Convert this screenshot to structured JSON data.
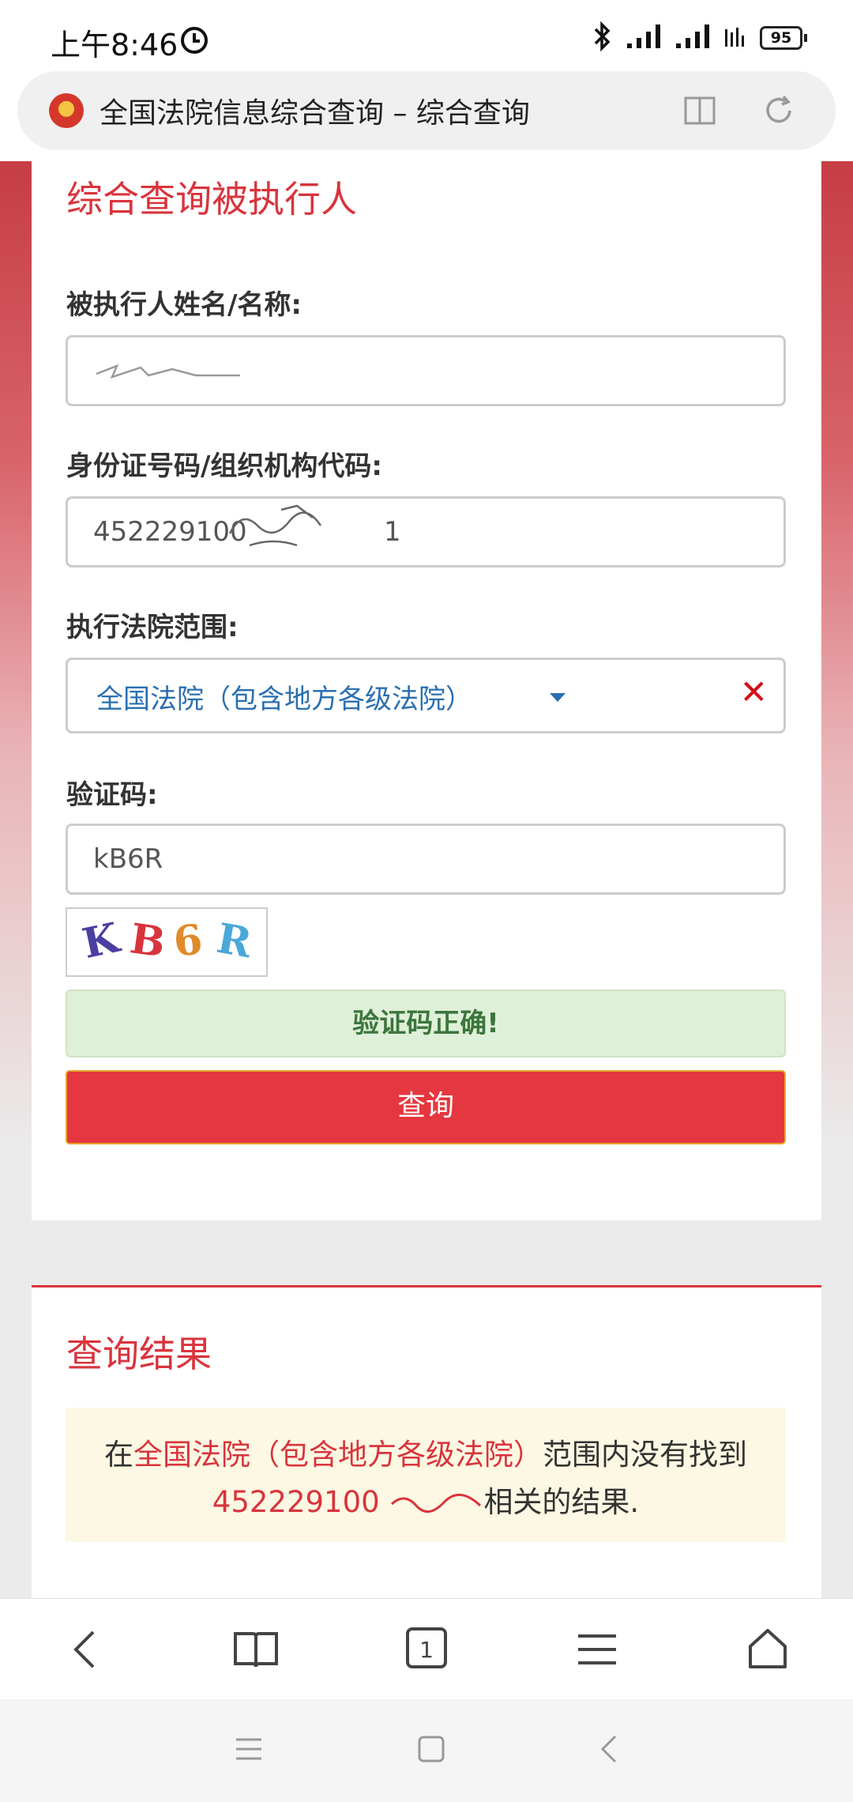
{
  "status_bar": {
    "time": "上午8:46",
    "battery": "95",
    "icons": [
      "alarm-icon",
      "bluetooth-icon",
      "signal-icon",
      "signal-icon",
      "wifi-bars-icon",
      "battery-icon"
    ]
  },
  "browser": {
    "page_title": "全国法院信息综合查询 – 综合查询",
    "icons": [
      "site-emblem-icon",
      "reader-mode-icon",
      "refresh-icon"
    ]
  },
  "form": {
    "title": "综合查询被执行人",
    "name_label": "被执行人姓名/名称:",
    "name_value": "",
    "id_label": "身份证号码/组织机构代码:",
    "id_value": "452229100",
    "id_value_tail": "1",
    "court_label": "执行法院范围:",
    "court_value": "全国法院（包含地方各级法院）",
    "captcha_label": "验证码:",
    "captcha_value": "kB6R",
    "captcha_image_chars": [
      "K",
      "B",
      "6",
      "R"
    ],
    "captcha_success": "验证码正确!",
    "query_button": "查询"
  },
  "result": {
    "title": "查询结果",
    "prefix": "在",
    "scope": "全国法院（包含地方各级法院）",
    "middle": "范围内没有找到",
    "query_id": "452229100",
    "suffix": "相关的结果."
  },
  "colors": {
    "accent_red": "#d9343d",
    "button_red": "#e5373f",
    "select_blue": "#2a6fb0",
    "success_green": "#3c763d",
    "success_bg": "#dff0d8",
    "result_bg": "#fcf8e3"
  }
}
